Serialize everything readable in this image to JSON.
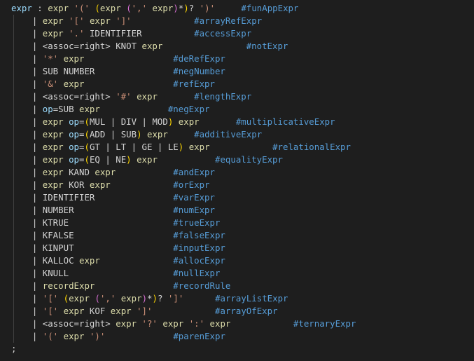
{
  "editor": {
    "language": "ANTLR grammar",
    "colors": {
      "background": "#1e1e1e",
      "text": "#d4d4d4",
      "rule_ref": "#dcdcaa",
      "string": "#ce9178",
      "label": "#9cdcfe",
      "bracket_level_1": "#ffd700",
      "bracket_level_2": "#da70d6",
      "bracket_level_3": "#179fff",
      "alt_label": "#569cd6"
    },
    "lines": [
      [
        [
          "expr",
          "t-rule"
        ],
        [
          " : ",
          "t-plain"
        ],
        [
          "expr",
          "t-expr"
        ],
        [
          " ",
          "t-plain"
        ],
        [
          "'('",
          "t-str"
        ],
        [
          " ",
          "t-plain"
        ],
        [
          "(",
          "t-p1"
        ],
        [
          "expr",
          "t-expr"
        ],
        [
          " ",
          "t-plain"
        ],
        [
          "(",
          "t-p2"
        ],
        [
          "','",
          "t-str"
        ],
        [
          " ",
          "t-plain"
        ],
        [
          "expr",
          "t-expr"
        ],
        [
          ")",
          "t-p2"
        ],
        [
          "*",
          "t-op"
        ],
        [
          ")",
          "t-p1"
        ],
        [
          "?",
          "t-op"
        ],
        [
          " ",
          "t-plain"
        ],
        [
          "')'",
          "t-str"
        ],
        [
          "     ",
          "t-plain"
        ],
        [
          "#funAppExpr",
          "t-comment"
        ]
      ],
      [
        [
          "    | ",
          "t-plain"
        ],
        [
          "expr",
          "t-expr"
        ],
        [
          " ",
          "t-plain"
        ],
        [
          "'['",
          "t-str"
        ],
        [
          " ",
          "t-plain"
        ],
        [
          "expr",
          "t-expr"
        ],
        [
          " ",
          "t-plain"
        ],
        [
          "']'",
          "t-str"
        ],
        [
          "            ",
          "t-plain"
        ],
        [
          "#arrayRefExpr",
          "t-comment"
        ]
      ],
      [
        [
          "    | ",
          "t-plain"
        ],
        [
          "expr",
          "t-expr"
        ],
        [
          " ",
          "t-plain"
        ],
        [
          "'.'",
          "t-str"
        ],
        [
          " IDENTIFIER          ",
          "t-plain"
        ],
        [
          "#accessExpr",
          "t-comment"
        ]
      ],
      [
        [
          "    | ",
          "t-plain"
        ],
        [
          "<assoc=right> KNOT ",
          "t-plain"
        ],
        [
          "expr",
          "t-expr"
        ],
        [
          "                ",
          "t-plain"
        ],
        [
          "#notExpr",
          "t-comment"
        ]
      ],
      [
        [
          "    | ",
          "t-plain"
        ],
        [
          "'*'",
          "t-str"
        ],
        [
          " ",
          "t-plain"
        ],
        [
          "expr",
          "t-expr"
        ],
        [
          "                 ",
          "t-plain"
        ],
        [
          "#deRefExpr",
          "t-comment"
        ]
      ],
      [
        [
          "    | ",
          "t-plain"
        ],
        [
          "SUB NUMBER               ",
          "t-plain"
        ],
        [
          "#negNumber",
          "t-comment"
        ]
      ],
      [
        [
          "    | ",
          "t-plain"
        ],
        [
          "'&'",
          "t-str"
        ],
        [
          " ",
          "t-plain"
        ],
        [
          "expr",
          "t-expr"
        ],
        [
          "                 ",
          "t-plain"
        ],
        [
          "#refExpr",
          "t-comment"
        ]
      ],
      [
        [
          "    | ",
          "t-plain"
        ],
        [
          "<assoc=right> ",
          "t-plain"
        ],
        [
          "'#'",
          "t-str"
        ],
        [
          " ",
          "t-plain"
        ],
        [
          "expr",
          "t-expr"
        ],
        [
          "       ",
          "t-plain"
        ],
        [
          "#lengthExpr",
          "t-comment"
        ]
      ],
      [
        [
          "    | ",
          "t-plain"
        ],
        [
          "op",
          "t-label"
        ],
        [
          "=SUB ",
          "t-plain"
        ],
        [
          "expr",
          "t-expr"
        ],
        [
          "             ",
          "t-plain"
        ],
        [
          "#negExpr",
          "t-comment"
        ]
      ],
      [
        [
          "    | ",
          "t-plain"
        ],
        [
          "expr",
          "t-expr"
        ],
        [
          " ",
          "t-plain"
        ],
        [
          "op",
          "t-label"
        ],
        [
          "=",
          "t-plain"
        ],
        [
          "(",
          "t-p1"
        ],
        [
          "MUL | DIV | MOD",
          "t-plain"
        ],
        [
          ")",
          "t-p1"
        ],
        [
          " ",
          "t-plain"
        ],
        [
          "expr",
          "t-expr"
        ],
        [
          "       ",
          "t-plain"
        ],
        [
          "#multiplicativeExpr",
          "t-comment"
        ]
      ],
      [
        [
          "    | ",
          "t-plain"
        ],
        [
          "expr",
          "t-expr"
        ],
        [
          " ",
          "t-plain"
        ],
        [
          "op",
          "t-label"
        ],
        [
          "=",
          "t-plain"
        ],
        [
          "(",
          "t-p1"
        ],
        [
          "ADD | SUB",
          "t-plain"
        ],
        [
          ")",
          "t-p1"
        ],
        [
          " ",
          "t-plain"
        ],
        [
          "expr",
          "t-expr"
        ],
        [
          "     ",
          "t-plain"
        ],
        [
          "#additiveExpr",
          "t-comment"
        ]
      ],
      [
        [
          "    | ",
          "t-plain"
        ],
        [
          "expr",
          "t-expr"
        ],
        [
          " ",
          "t-plain"
        ],
        [
          "op",
          "t-label"
        ],
        [
          "=",
          "t-plain"
        ],
        [
          "(",
          "t-p1"
        ],
        [
          "GT | LT | GE | LE",
          "t-plain"
        ],
        [
          ")",
          "t-p1"
        ],
        [
          " ",
          "t-plain"
        ],
        [
          "expr",
          "t-expr"
        ],
        [
          "            ",
          "t-plain"
        ],
        [
          "#relationalExpr",
          "t-comment"
        ]
      ],
      [
        [
          "    | ",
          "t-plain"
        ],
        [
          "expr",
          "t-expr"
        ],
        [
          " ",
          "t-plain"
        ],
        [
          "op",
          "t-label"
        ],
        [
          "=",
          "t-plain"
        ],
        [
          "(",
          "t-p1"
        ],
        [
          "EQ | NE",
          "t-plain"
        ],
        [
          ")",
          "t-p1"
        ],
        [
          " ",
          "t-plain"
        ],
        [
          "expr",
          "t-expr"
        ],
        [
          "           ",
          "t-plain"
        ],
        [
          "#equalityExpr",
          "t-comment"
        ]
      ],
      [
        [
          "    | ",
          "t-plain"
        ],
        [
          "expr",
          "t-expr"
        ],
        [
          " KAND ",
          "t-plain"
        ],
        [
          "expr",
          "t-expr"
        ],
        [
          "           ",
          "t-plain"
        ],
        [
          "#andExpr",
          "t-comment"
        ]
      ],
      [
        [
          "    | ",
          "t-plain"
        ],
        [
          "expr",
          "t-expr"
        ],
        [
          " KOR ",
          "t-plain"
        ],
        [
          "expr",
          "t-expr"
        ],
        [
          "            ",
          "t-plain"
        ],
        [
          "#orExpr",
          "t-comment"
        ]
      ],
      [
        [
          "    | ",
          "t-plain"
        ],
        [
          "IDENTIFIER               ",
          "t-plain"
        ],
        [
          "#varExpr",
          "t-comment"
        ]
      ],
      [
        [
          "    | ",
          "t-plain"
        ],
        [
          "NUMBER                   ",
          "t-plain"
        ],
        [
          "#numExpr",
          "t-comment"
        ]
      ],
      [
        [
          "    | ",
          "t-plain"
        ],
        [
          "KTRUE                    ",
          "t-plain"
        ],
        [
          "#trueExpr",
          "t-comment"
        ]
      ],
      [
        [
          "    | ",
          "t-plain"
        ],
        [
          "KFALSE                   ",
          "t-plain"
        ],
        [
          "#falseExpr",
          "t-comment"
        ]
      ],
      [
        [
          "    | ",
          "t-plain"
        ],
        [
          "KINPUT                   ",
          "t-plain"
        ],
        [
          "#inputExpr",
          "t-comment"
        ]
      ],
      [
        [
          "    | ",
          "t-plain"
        ],
        [
          "KALLOC ",
          "t-plain"
        ],
        [
          "expr",
          "t-expr"
        ],
        [
          "              ",
          "t-plain"
        ],
        [
          "#allocExpr",
          "t-comment"
        ]
      ],
      [
        [
          "    | ",
          "t-plain"
        ],
        [
          "KNULL                    ",
          "t-plain"
        ],
        [
          "#nullExpr",
          "t-comment"
        ]
      ],
      [
        [
          "    | ",
          "t-plain"
        ],
        [
          "recordExpr",
          "t-expr"
        ],
        [
          "               ",
          "t-plain"
        ],
        [
          "#recordRule",
          "t-comment"
        ]
      ],
      [
        [
          "    | ",
          "t-plain"
        ],
        [
          "'['",
          "t-str"
        ],
        [
          " ",
          "t-plain"
        ],
        [
          "(",
          "t-p1"
        ],
        [
          "expr",
          "t-expr"
        ],
        [
          " ",
          "t-plain"
        ],
        [
          "(",
          "t-p2"
        ],
        [
          "','",
          "t-str"
        ],
        [
          " ",
          "t-plain"
        ],
        [
          "expr",
          "t-expr"
        ],
        [
          ")",
          "t-p2"
        ],
        [
          "*",
          "t-op"
        ],
        [
          ")",
          "t-p1"
        ],
        [
          "?",
          "t-op"
        ],
        [
          " ",
          "t-plain"
        ],
        [
          "']'",
          "t-str"
        ],
        [
          "      ",
          "t-plain"
        ],
        [
          "#arrayListExpr",
          "t-comment"
        ]
      ],
      [
        [
          "    | ",
          "t-plain"
        ],
        [
          "'['",
          "t-str"
        ],
        [
          " ",
          "t-plain"
        ],
        [
          "expr",
          "t-expr"
        ],
        [
          " KOF ",
          "t-plain"
        ],
        [
          "expr",
          "t-expr"
        ],
        [
          " ",
          "t-plain"
        ],
        [
          "']'",
          "t-str"
        ],
        [
          "            ",
          "t-plain"
        ],
        [
          "#arrayOfExpr",
          "t-comment"
        ]
      ],
      [
        [
          "    | ",
          "t-plain"
        ],
        [
          "<assoc=right> ",
          "t-plain"
        ],
        [
          "expr",
          "t-expr"
        ],
        [
          " ",
          "t-plain"
        ],
        [
          "'?'",
          "t-str"
        ],
        [
          " ",
          "t-plain"
        ],
        [
          "expr",
          "t-expr"
        ],
        [
          " ",
          "t-plain"
        ],
        [
          "':'",
          "t-str"
        ],
        [
          " ",
          "t-plain"
        ],
        [
          "expr",
          "t-expr"
        ],
        [
          "            ",
          "t-plain"
        ],
        [
          "#ternaryExpr",
          "t-comment"
        ]
      ],
      [
        [
          "    | ",
          "t-plain"
        ],
        [
          "'('",
          "t-str"
        ],
        [
          " ",
          "t-plain"
        ],
        [
          "expr",
          "t-expr"
        ],
        [
          " ",
          "t-plain"
        ],
        [
          "')'",
          "t-str"
        ],
        [
          "             ",
          "t-plain"
        ],
        [
          "#parenExpr",
          "t-comment"
        ]
      ],
      [
        [
          ";",
          "t-plain"
        ]
      ]
    ]
  }
}
